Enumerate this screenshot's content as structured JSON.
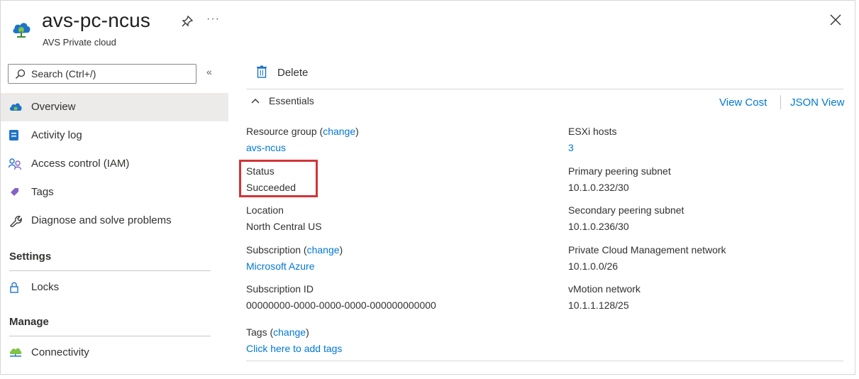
{
  "header": {
    "title": "avs-pc-ncus",
    "subtitle": "AVS Private cloud",
    "more": "···"
  },
  "sidebar": {
    "search_placeholder": "Search (Ctrl+/)",
    "collapse": "«",
    "items": [
      {
        "label": "Overview",
        "icon": "cloud-icon"
      },
      {
        "label": "Activity log",
        "icon": "log-icon"
      },
      {
        "label": "Access control (IAM)",
        "icon": "people-icon"
      },
      {
        "label": "Tags",
        "icon": "tag-icon"
      },
      {
        "label": "Diagnose and solve problems",
        "icon": "wrench-icon"
      }
    ],
    "sections": {
      "settings": {
        "title": "Settings",
        "items": [
          {
            "label": "Locks",
            "icon": "lock-icon"
          }
        ]
      },
      "manage": {
        "title": "Manage",
        "items": [
          {
            "label": "Connectivity",
            "icon": "network-cloud-icon"
          }
        ]
      }
    }
  },
  "toolbar": {
    "delete_label": "Delete"
  },
  "essentials": {
    "toggle_label": "Essentials",
    "view_cost": "View Cost",
    "json_view": "JSON View",
    "left": [
      {
        "label": "Resource group",
        "change": "change",
        "value": "avs-ncus",
        "value_is_link": true
      },
      {
        "label": "Status",
        "value": "Succeeded"
      },
      {
        "label": "Location",
        "value": "North Central US"
      },
      {
        "label": "Subscription",
        "change": "change",
        "value": "Microsoft Azure",
        "value_is_link": true
      },
      {
        "label": "Subscription ID",
        "value": "00000000-0000-0000-0000-000000000000"
      },
      {
        "label": "Tags",
        "change": "change",
        "value": "Click here to add tags",
        "value_is_link": true
      }
    ],
    "right": [
      {
        "label": "ESXi hosts",
        "value": "3",
        "value_is_link": true
      },
      {
        "label": "Primary peering subnet",
        "value": "10.1.0.232/30"
      },
      {
        "label": "Secondary peering subnet",
        "value": "10.1.0.236/30"
      },
      {
        "label": "Private Cloud Management network",
        "value": "10.1.0.0/26"
      },
      {
        "label": "vMotion network",
        "value": "10.1.1.128/25"
      }
    ]
  },
  "colors": {
    "accent": "#0078d4",
    "highlight": "#d13438",
    "selected_bg": "#edebe9"
  }
}
